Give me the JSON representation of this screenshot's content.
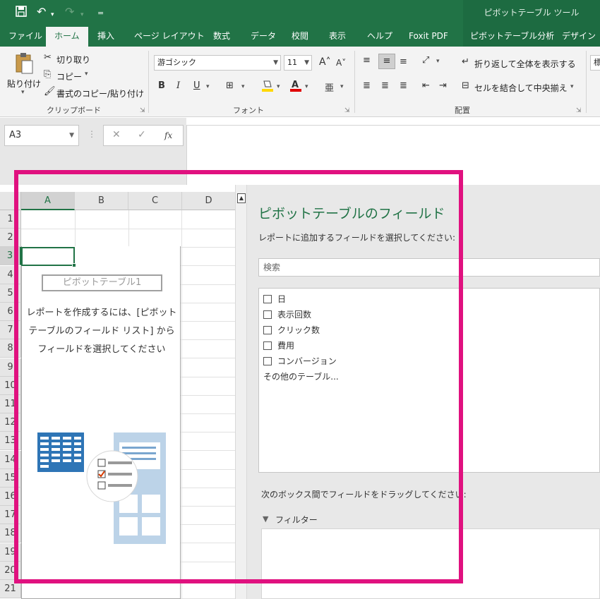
{
  "app": {
    "context_title": "ピボットテーブル ツール",
    "undo_icon": "undo-icon",
    "redo_icon": "redo-icon",
    "save_icon": "save-icon",
    "qat_more": "="
  },
  "tabs": [
    {
      "label": "ファイル"
    },
    {
      "label": "ホーム"
    },
    {
      "label": "挿入"
    },
    {
      "label": "ページ レイアウト"
    },
    {
      "label": "数式"
    },
    {
      "label": "データ"
    },
    {
      "label": "校閲"
    },
    {
      "label": "表示"
    },
    {
      "label": "ヘルプ"
    },
    {
      "label": "Foxit PDF"
    },
    {
      "label": "ピボットテーブル分析"
    },
    {
      "label": "デザイン"
    }
  ],
  "ribbon": {
    "clipboard": {
      "paste": "貼り付け",
      "cut": "切り取り",
      "copy": "コピー",
      "format_painter": "書式のコピー/貼り付け",
      "group": "クリップボード"
    },
    "font": {
      "name": "游ゴシック",
      "size": "11",
      "bold": "B",
      "italic": "I",
      "underline": "U",
      "group": "フォント"
    },
    "alignment": {
      "wrap": "折り返して全体を表示する",
      "merge": "セルを結合して中央揃え",
      "group": "配置"
    },
    "number_format": "標"
  },
  "formula_bar": {
    "name_box": "A3",
    "cancel": "✕",
    "enter": "✓",
    "fx": "fx",
    "value": ""
  },
  "grid": {
    "columns": [
      "A",
      "B",
      "C",
      "D"
    ],
    "rows": [
      "1",
      "2",
      "3",
      "4",
      "5",
      "6",
      "7",
      "8",
      "9",
      "10",
      "11",
      "12",
      "13",
      "14",
      "15",
      "16",
      "17",
      "18",
      "19",
      "20",
      "21"
    ],
    "selected_cell": "A3"
  },
  "pivot": {
    "name": "ピボットテーブル1",
    "message": "レポートを作成するには、[ピボットテーブルのフィールド リスト] からフィールドを選択してください"
  },
  "field_pane": {
    "title": "ピボットテーブルのフィールド",
    "subtitle": "レポートに追加するフィールドを選択してください:",
    "search_placeholder": "検索",
    "fields": [
      {
        "label": "日"
      },
      {
        "label": "表示回数"
      },
      {
        "label": "クリック数"
      },
      {
        "label": "費用"
      },
      {
        "label": "コンバージョン"
      }
    ],
    "more_tables": "その他のテーブル...",
    "drag_instruction": "次のボックス間でフィールドをドラッグしてください:",
    "filter_label": "フィルター"
  },
  "colors": {
    "excel_green": "#217346",
    "highlight": "#e0117f"
  }
}
